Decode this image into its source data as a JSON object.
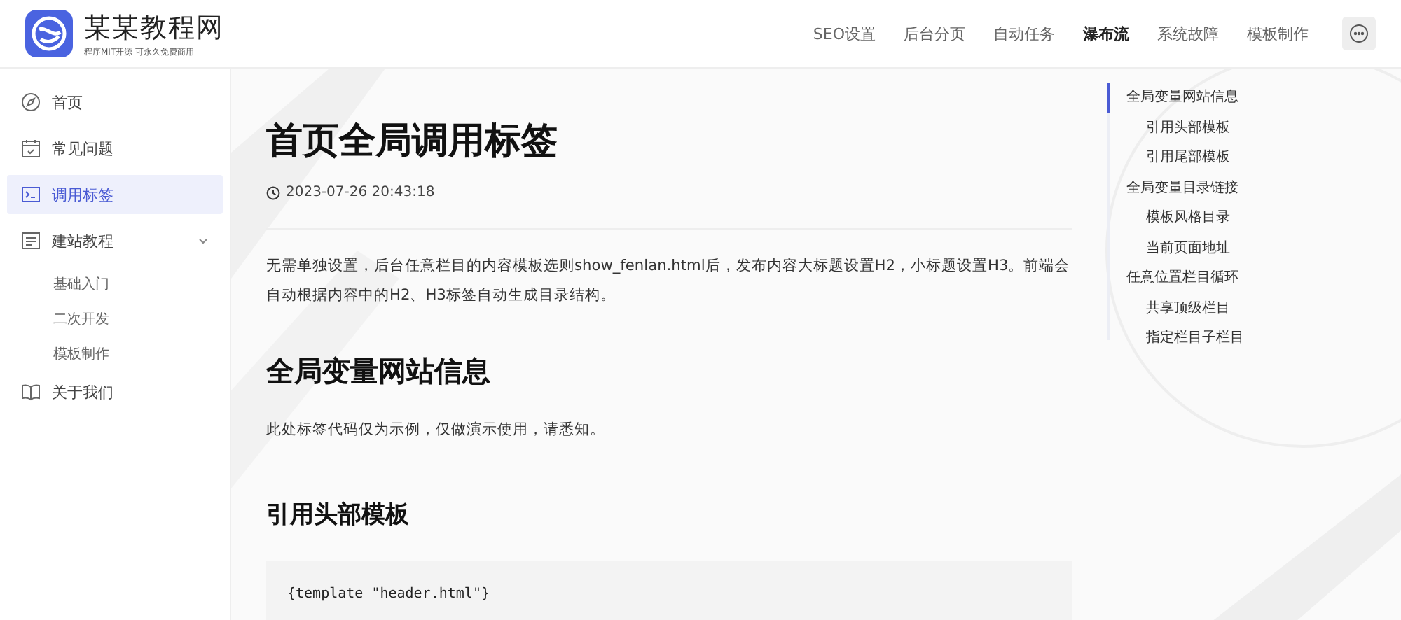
{
  "logo": {
    "title": "某某教程网",
    "subtitle": "程序MIT开源 可永久免费商用"
  },
  "nav": [
    {
      "label": "SEO设置",
      "selected": false
    },
    {
      "label": "后台分页",
      "selected": false
    },
    {
      "label": "自动任务",
      "selected": false
    },
    {
      "label": "瀑布流",
      "selected": true
    },
    {
      "label": "系统故障",
      "selected": false
    },
    {
      "label": "模板制作",
      "selected": false
    }
  ],
  "sidebar": {
    "items": [
      {
        "label": "首页",
        "selected": false
      },
      {
        "label": "常见问题",
        "selected": false
      },
      {
        "label": "调用标签",
        "selected": true
      },
      {
        "label": "建站教程",
        "selected": false,
        "expanded": true,
        "children": [
          {
            "label": "基础入门"
          },
          {
            "label": "二次开发"
          },
          {
            "label": "模板制作"
          }
        ]
      },
      {
        "label": "关于我们",
        "selected": false
      }
    ]
  },
  "article": {
    "title": "首页全局调用标签",
    "date": "2023-07-26 20:43:18",
    "intro": "无需单独设置，后台任意栏目的内容模板选则show_fenlan.html后，发布内容大标题设置H2，小标题设置H3。前端会自动根据内容中的H2、H3标签自动生成目录结构。",
    "h2": "全局变量网站信息",
    "note": "此处标签代码仅为示例，仅做演示使用，请悉知。",
    "h3": "引用头部模板",
    "code": "{template \"header.html\"}"
  },
  "toc": [
    {
      "label": "全局变量网站信息",
      "selected": true,
      "children": [
        {
          "label": "引用头部模板",
          "selected": false
        },
        {
          "label": "引用尾部模板",
          "selected": false
        }
      ]
    },
    {
      "label": "全局变量目录链接",
      "selected": false,
      "children": [
        {
          "label": "模板风格目录",
          "selected": false
        },
        {
          "label": "当前页面地址",
          "selected": false
        }
      ]
    },
    {
      "label": "任意位置栏目循环",
      "selected": false,
      "children": [
        {
          "label": "共享顶级栏目",
          "selected": false
        },
        {
          "label": "指定栏目子栏目",
          "selected": false
        }
      ]
    }
  ]
}
